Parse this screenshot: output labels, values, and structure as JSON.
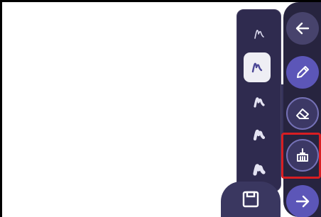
{
  "brush_sizes": [
    {
      "name": "brush-size-1",
      "selected": false,
      "stroke": 1.6,
      "color": "#d9d8ec"
    },
    {
      "name": "brush-size-2",
      "selected": true,
      "stroke": 2.4,
      "color": "#4c4896"
    },
    {
      "name": "brush-size-3",
      "selected": false,
      "stroke": 3.2,
      "color": "#e4e3f2"
    },
    {
      "name": "brush-size-4",
      "selected": false,
      "stroke": 4.2,
      "color": "#e4e3f2"
    },
    {
      "name": "brush-size-5",
      "selected": false,
      "stroke": 5.2,
      "color": "#e4e3f2"
    }
  ],
  "toolbar": {
    "tools": [
      "back",
      "pen",
      "eraser",
      "clear",
      "next"
    ],
    "highlighted_tool": "clear"
  },
  "colors": {
    "panel": "#2f2b4f",
    "toolbar": "#27243f",
    "accent": "#5c56b8",
    "highlight": "#d81e22",
    "canvas": "#ffffff"
  }
}
